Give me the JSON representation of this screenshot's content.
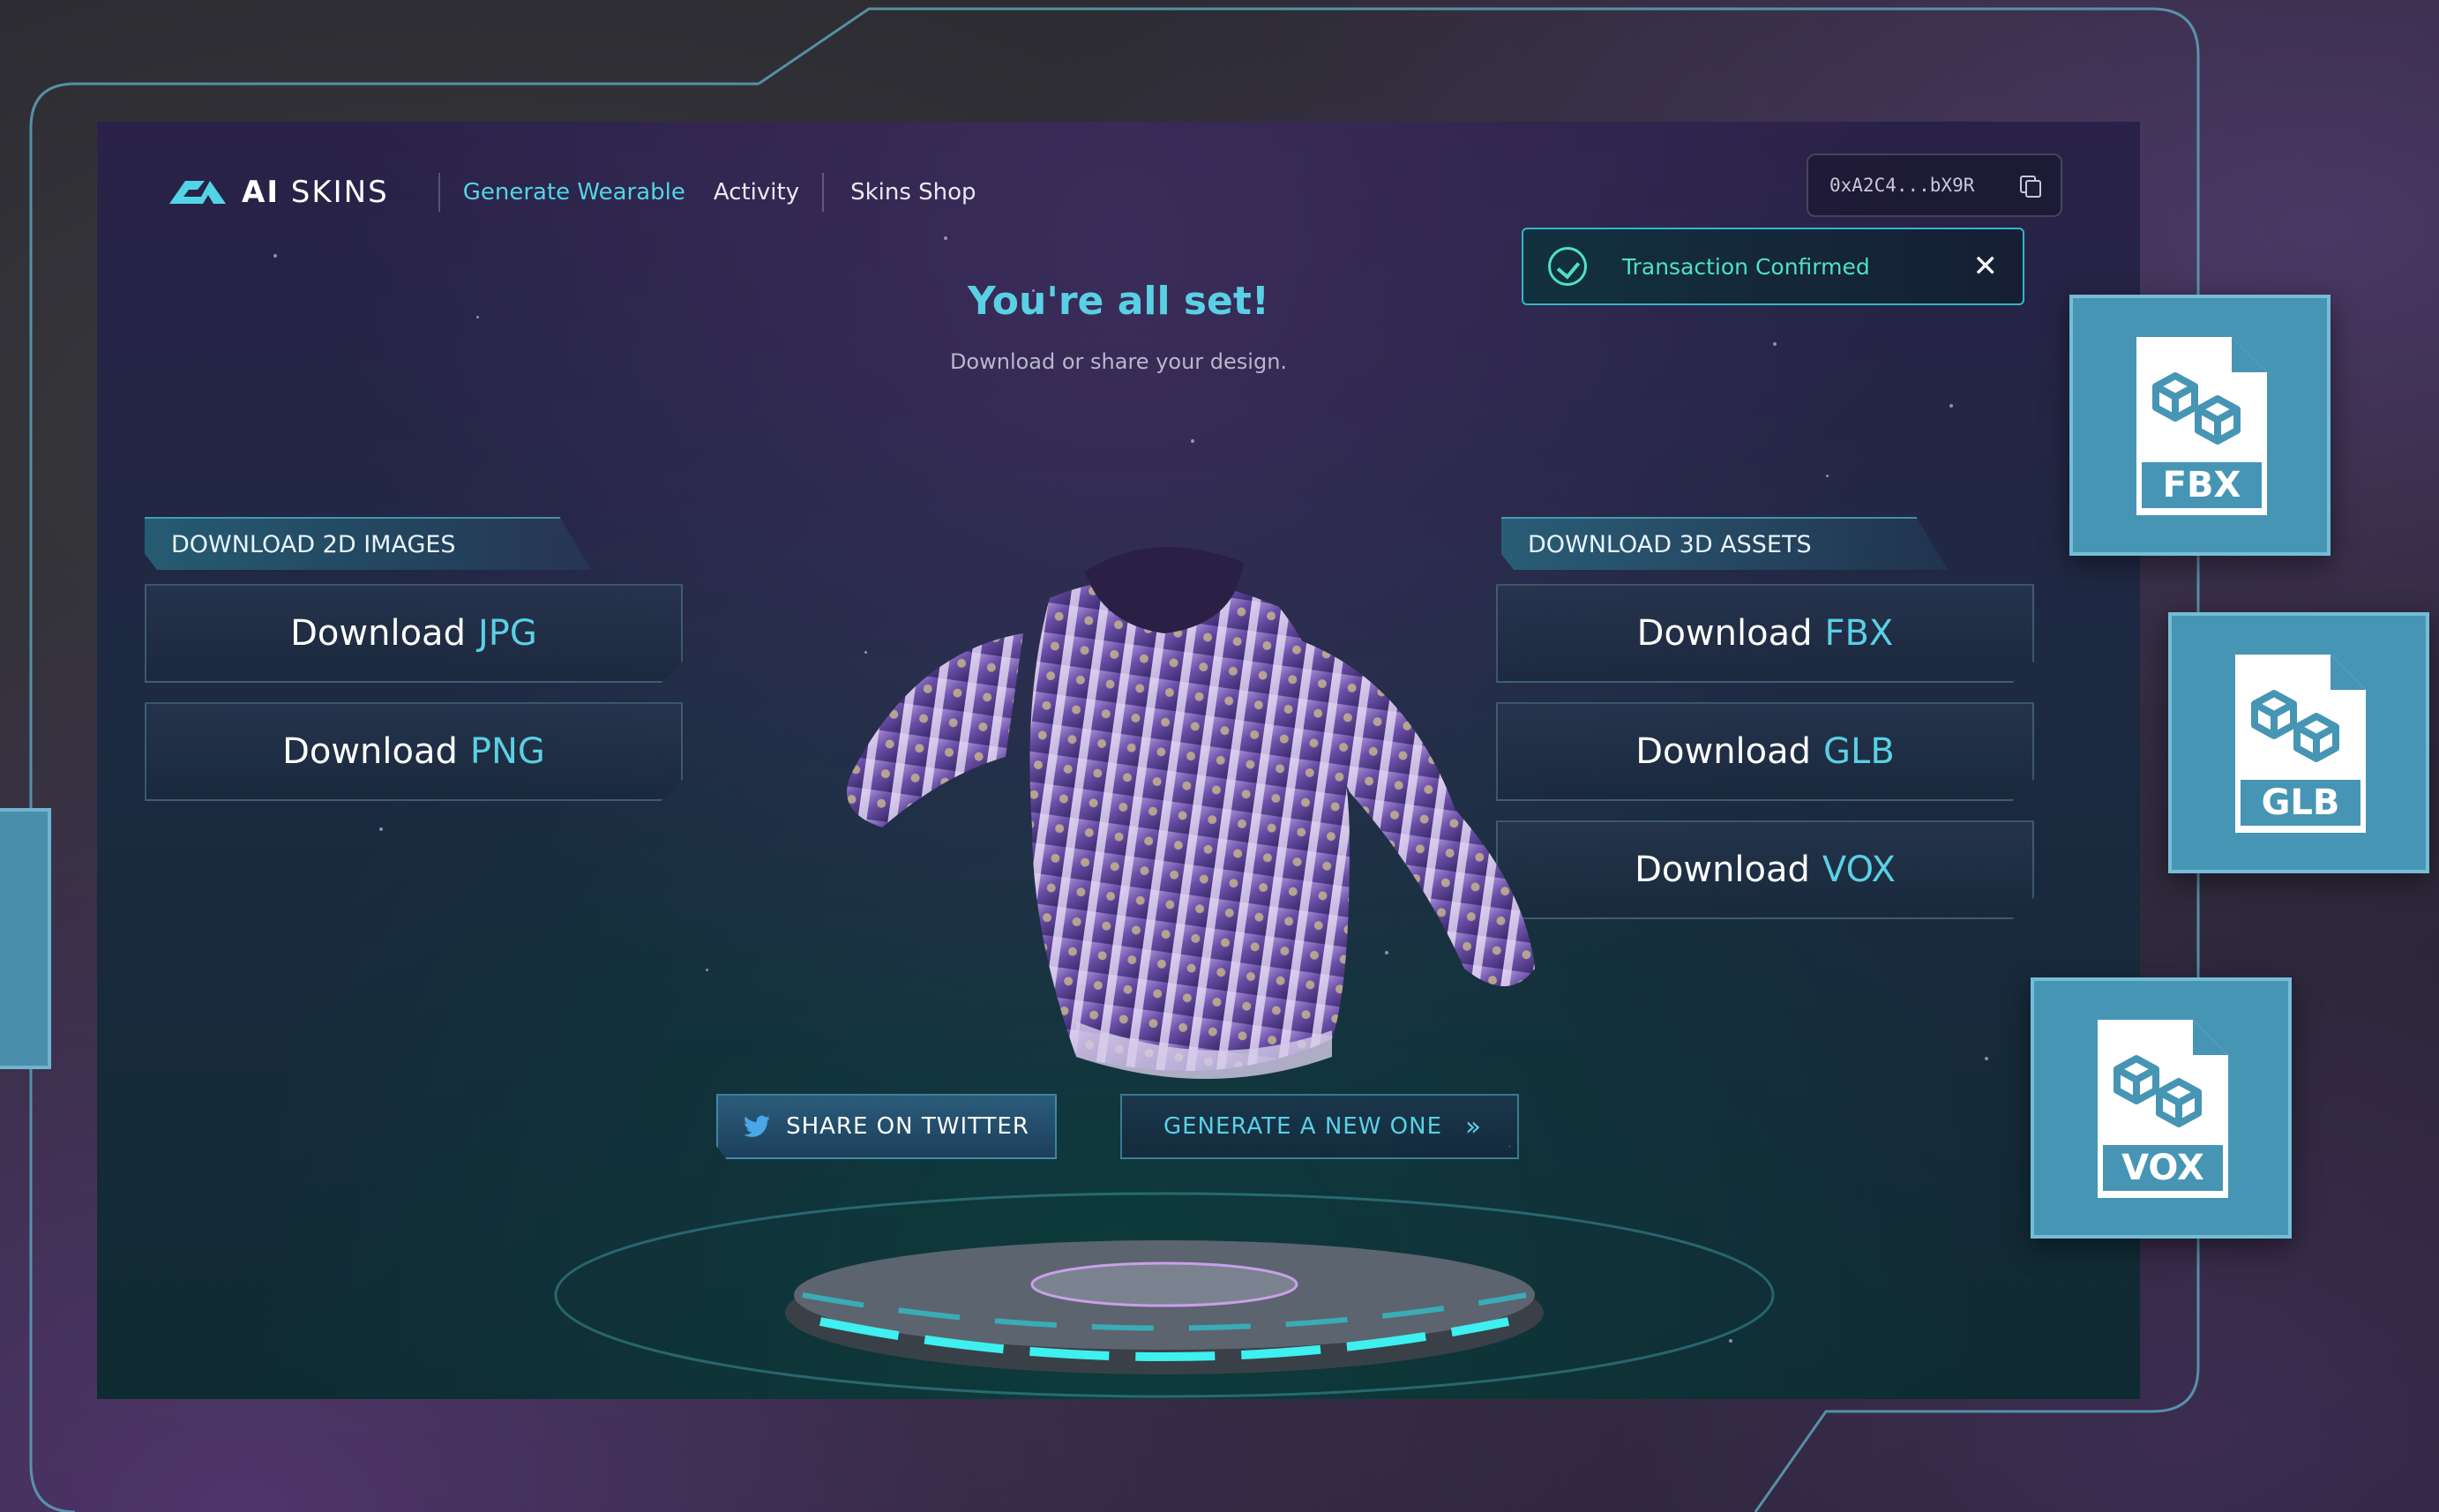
{
  "nav": {
    "logo_text_bold": "AI",
    "logo_text": "SKINS",
    "items": [
      {
        "label": "Generate Wearable",
        "active": true
      },
      {
        "label": "Activity",
        "active": false
      },
      {
        "label": "Skins Shop",
        "active": false
      }
    ]
  },
  "wallet": {
    "address": "0xA2C4...bX9R"
  },
  "toast": {
    "message": "Transaction Confirmed"
  },
  "hero": {
    "title": "You're all set!",
    "subtitle": "Download or share your design."
  },
  "downloads_2d": {
    "label": "DOWNLOAD 2D IMAGES",
    "buttons": [
      {
        "prefix": "Download",
        "format": "JPG"
      },
      {
        "prefix": "Download",
        "format": "PNG"
      }
    ]
  },
  "downloads_3d": {
    "label": "DOWNLOAD 3D ASSETS",
    "buttons": [
      {
        "prefix": "Download",
        "format": "FBX"
      },
      {
        "prefix": "Download",
        "format": "GLB"
      },
      {
        "prefix": "Download",
        "format": "VOX"
      }
    ]
  },
  "actions": {
    "share_label": "SHARE ON TWITTER",
    "generate_label": "GENERATE A NEW ONE"
  },
  "file_cards": [
    {
      "label": "FBX"
    },
    {
      "label": "GLB"
    },
    {
      "label": "VOX"
    }
  ],
  "colors": {
    "accent": "#5ad0e4",
    "success": "#4fe0c8",
    "card": "#4795b5"
  }
}
